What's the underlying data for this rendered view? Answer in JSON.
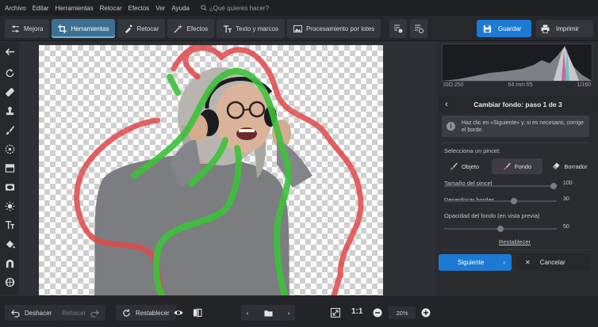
{
  "menu": {
    "items": [
      "Archivo",
      "Editar",
      "Herramientas",
      "Retocar",
      "Efectos",
      "Ver",
      "Ayuda"
    ],
    "search_placeholder": "¿Qué quieres hacer?"
  },
  "toolbar": {
    "tabs": [
      {
        "label": "Mejora",
        "icon": "sliders-icon"
      },
      {
        "label": "Herramientas",
        "icon": "crop-icon",
        "active": true
      },
      {
        "label": "Retocar",
        "icon": "retouch-brush-icon"
      },
      {
        "label": "Efectos",
        "icon": "magic-wand-icon"
      },
      {
        "label": "Texto y marcos",
        "icon": "text-icon"
      },
      {
        "label": "Procesamiento por lotes",
        "icon": "batch-images-icon"
      }
    ],
    "save_label": "Guardar",
    "print_label": "Imprimir",
    "accent": "#1d7ad4"
  },
  "left_tools": [
    "back-arrow-icon",
    "rotate-icon",
    "healing-icon",
    "stamp-icon",
    "brush-icon",
    "radial-icon",
    "gradient-icon",
    "vignette-icon",
    "light-icon",
    "text-tool-icon",
    "paint-bucket-icon",
    "magnet-icon",
    "globe-icon"
  ],
  "histogram": {
    "iso": "ISO 250",
    "lens": "64 mm f/5",
    "shutter": "1/160"
  },
  "panel": {
    "title": "Cambiar fondo: paso 1 de 3",
    "hint": "Haz clic en «Siguiente» y, si es necesario, corrige el borde.",
    "brush_label": "Selecciona un pincel:",
    "brushes": [
      "Objeto",
      "Fondo",
      "Borrador"
    ],
    "active_brush": "Fondo",
    "brush_size_label": "Tamaño del pincel",
    "brush_size": "100",
    "blur_label": "Desenfocar bordes",
    "blur": "30",
    "opacity_label": "Opacidad del fondo (en vista previa)",
    "opacity": "50",
    "reset_label": "Restablecer",
    "next_label": "Siguiente",
    "cancel_label": "Cancelar"
  },
  "bottom": {
    "undo_label": "Deshacer",
    "redo_label": "Rehacer",
    "reset_label": "Restablecer",
    "one_to_one": "1:1",
    "zoom": "20%"
  }
}
